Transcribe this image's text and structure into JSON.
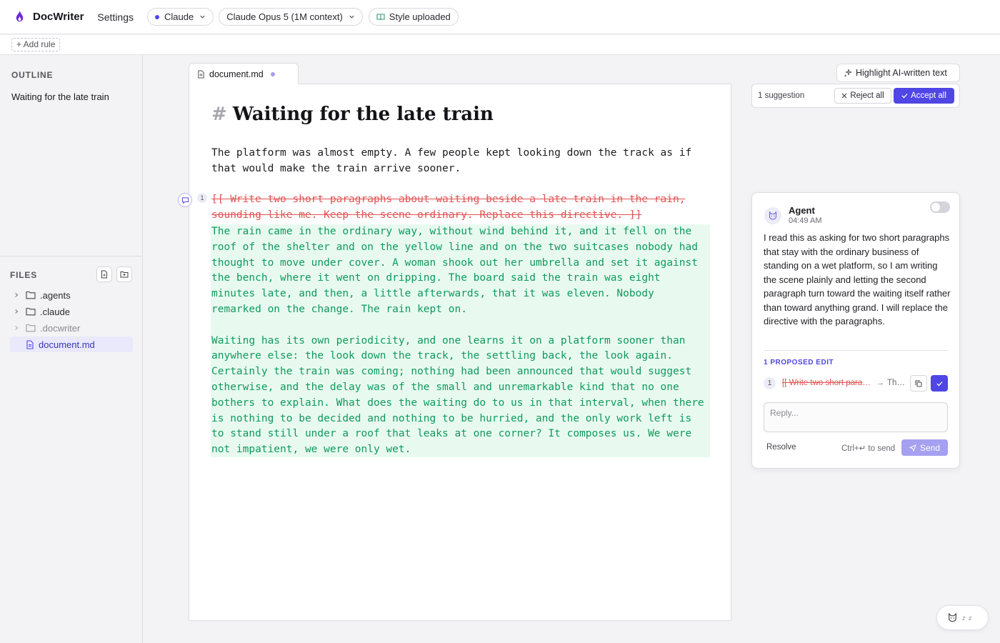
{
  "app": {
    "name": "DocWriter",
    "settings_label": "Settings",
    "provider": "Claude",
    "model": "Claude Opus 5 (1M context)",
    "style_label": "Style uploaded",
    "accent_color": "#4f46e5"
  },
  "rules": {
    "add_rule_label": "+ Add rule"
  },
  "sidebar": {
    "outline_heading": "OUTLINE",
    "outline_items": [
      "Waiting for the late train"
    ],
    "files_heading": "FILES",
    "files": [
      {
        "name": ".agents",
        "type": "folder"
      },
      {
        "name": ".claude",
        "type": "folder"
      },
      {
        "name": ".docwriter",
        "type": "folder"
      },
      {
        "name": "document.md",
        "type": "file",
        "active": true
      }
    ]
  },
  "editor": {
    "tab_name": "document.md",
    "title_hash": "#",
    "title": "Waiting for the late train",
    "paragraph1": "The platform was almost empty. A few people kept looking down the track as if that would make the train arrive sooner.",
    "deleted_text": "[[ Write two short paragraphs about waiting beside a late train in the rain, sounding like me. Keep the scene ordinary. Replace this directive. ]]",
    "inserted_paragraphs": [
      "The rain came in the ordinary way, without wind behind it, and it fell on the roof of the shelter and on the yellow line and on the two suitcases nobody had thought to move under cover. A woman shook out her umbrella and set it against the bench, where it went on dripping. The board said the train was eight minutes late, and then, a little afterwards, that it was eleven. Nobody remarked on the change. The rain kept on.",
      "Waiting has its own periodicity, and one learns it on a platform sooner than anywhere else: the look down the track, the settling back, the look again. Certainly the train was coming; nothing had been announced that would suggest otherwise, and the delay was of the small and unremarkable kind that no one bothers to explain. What does the waiting do to us in that interval, when there is nothing to be decided and nothing to be hurried, and the only work left is to stand still under a roof that leaks at one corner? It composes us. We were not impatient, we were only wet."
    ],
    "comment_count": "1"
  },
  "suggestions": {
    "highlight_label": "Highlight AI-written text",
    "count_label": "1 suggestion",
    "reject_all_label": "Reject all",
    "accept_all_label": "Accept all"
  },
  "agent_card": {
    "name": "Agent",
    "time": "04:49 AM",
    "message": "I read this as asking for two short paragraphs that stay with the ordinary business of standing on a wet platform, so I am writing the scene plainly and letting the second paragraph turn toward the waiting itself rather than toward anything grand. I will replace the directive with the paragraphs.",
    "edits_heading": "1 PROPOSED EDIT",
    "edit_number": "1",
    "edit_old": "[[ Write two short paragraphs",
    "edit_arrow": "→",
    "edit_new": "The rain came",
    "reply_placeholder": "Reply...",
    "resolve_label": "Resolve",
    "shortcut_hint": "Ctrl+↵ to send",
    "send_label": "Send"
  },
  "status": {
    "sleep_label": "z z"
  }
}
